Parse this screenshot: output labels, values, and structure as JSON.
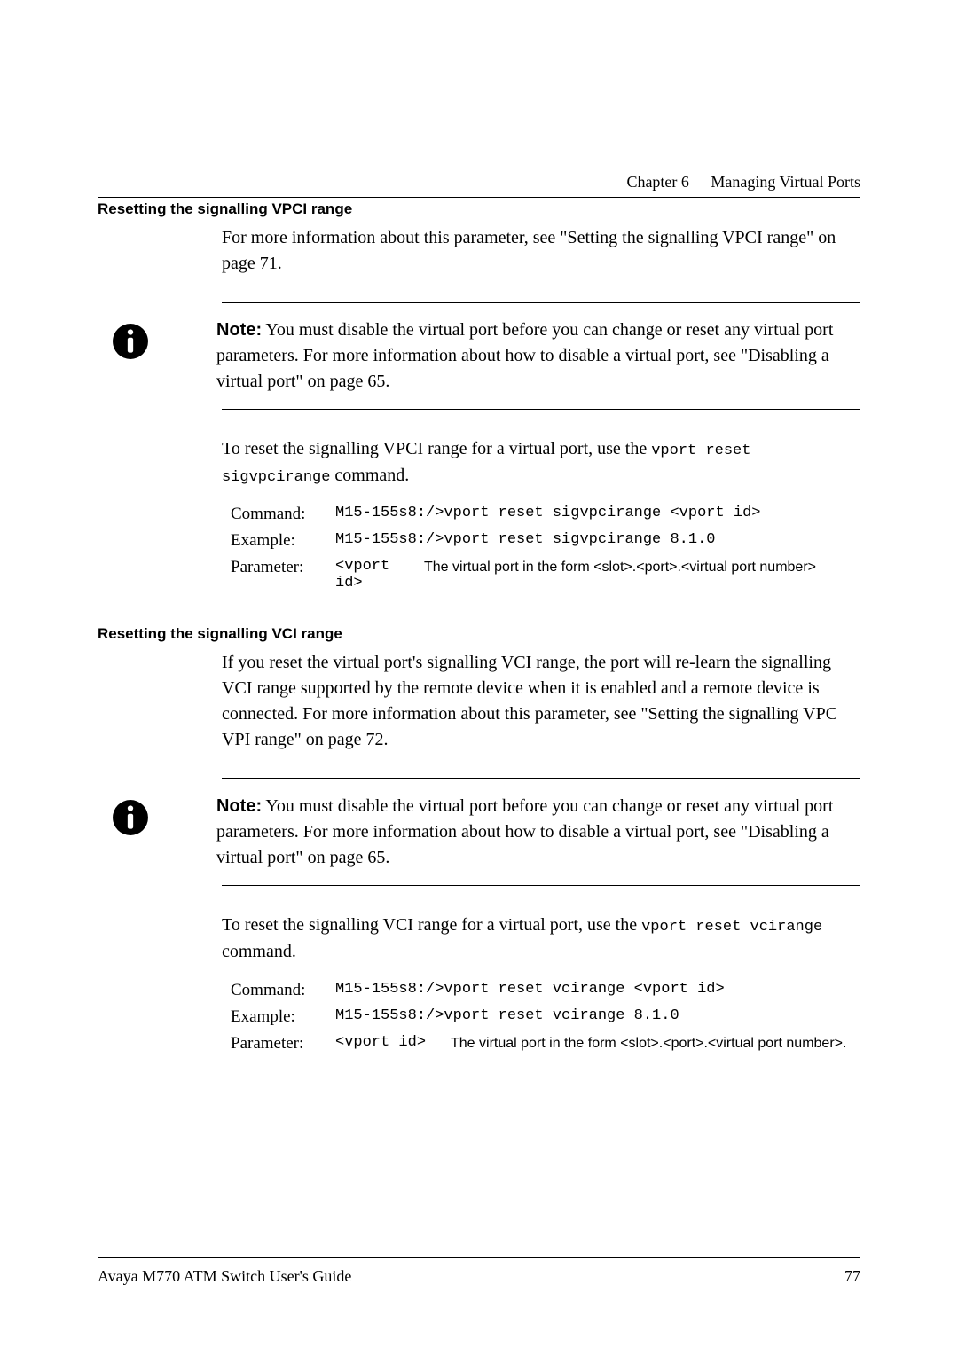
{
  "header": {
    "chapter_label": "Chapter 6",
    "chapter_title": "Managing Virtual Ports"
  },
  "section1": {
    "heading": "Resetting the signalling VPCI range",
    "intro": "For more information about this parameter, see \"Setting the signalling VPCI range\" on page 71.",
    "note_label": "Note:",
    "note_text": "You must disable the virtual port before you can change or reset any virtual port parameters. For more information about how to disable a virtual port, see \"Disabling a virtual port\" on page 65.",
    "lead_pre": "To reset the signalling VPCI range for a virtual port, use the ",
    "lead_code": "vport reset sigvpcirange",
    "lead_post": " command.",
    "cmd": {
      "label_command": "Command:",
      "command": "M15-155s8:/>vport reset sigvpcirange <vport id>",
      "label_example": "Example:",
      "example": "M15-155s8:/>vport reset sigvpcirange 8.1.0",
      "label_parameter": "Parameter:",
      "param_name": "<vport id>",
      "param_desc": "The virtual port in the form <slot>.<port>.<virtual port number>"
    }
  },
  "section2": {
    "heading": "Resetting the signalling VCI range",
    "intro": "If you reset the virtual port's signalling VCI range, the port will re-learn the signalling VCI range supported by the remote device when it is enabled and a remote device is connected. For more information about this parameter, see \"Setting the signalling VPC VPI range\" on page 72.",
    "note_label": "Note:",
    "note_text": "You must disable the virtual port before you can change or reset any virtual port parameters. For more information about how to disable a virtual port, see \"Disabling a virtual port\" on page 65.",
    "lead_pre": "To reset the signalling VCI range for a virtual port, use the ",
    "lead_code": "vport reset vcirange",
    "lead_post": " command.",
    "cmd": {
      "label_command": "Command:",
      "command": "M15-155s8:/>vport reset vcirange <vport id>",
      "label_example": "Example:",
      "example": "M15-155s8:/>vport reset vcirange 8.1.0",
      "label_parameter": "Parameter:",
      "param_name": "<vport id>",
      "param_desc": "The virtual port in the form <slot>.<port>.<virtual port number>."
    }
  },
  "footer": {
    "book": "Avaya M770 ATM Switch User's Guide",
    "page": "77"
  }
}
